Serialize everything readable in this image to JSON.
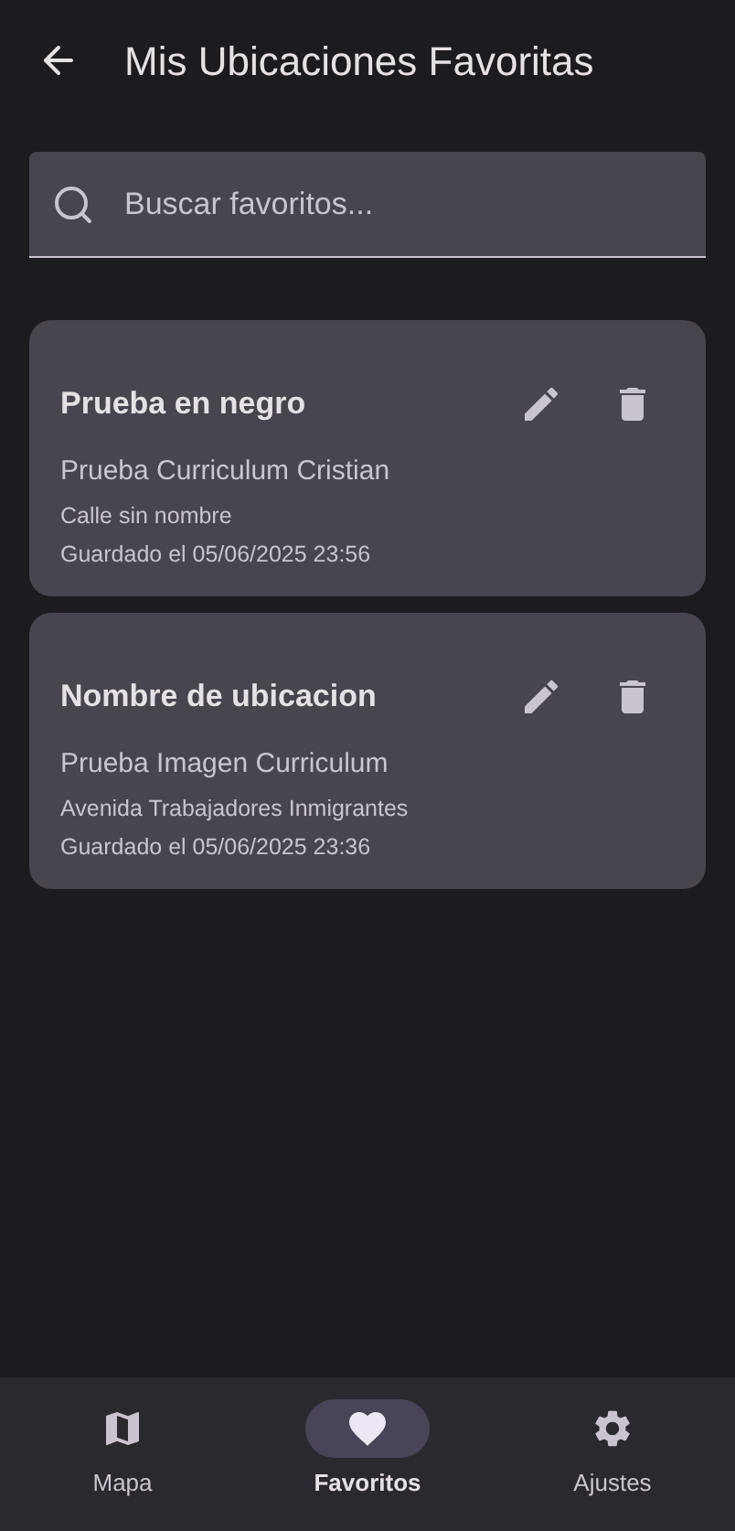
{
  "app_bar": {
    "title": "Mis Ubicaciones Favoritas"
  },
  "search": {
    "placeholder": "Buscar favoritos..."
  },
  "favorites": [
    {
      "name": "Prueba en negro",
      "description": "Prueba Curriculum Cristian",
      "address": "Calle sin nombre",
      "saved": "Guardado el 05/06/2025 23:56"
    },
    {
      "name": "Nombre de ubicacion",
      "description": "Prueba Imagen Curriculum",
      "address": "Avenida Trabajadores Inmigrantes",
      "saved": "Guardado el 05/06/2025 23:36"
    }
  ],
  "nav": [
    {
      "kind": "map",
      "label": "Mapa",
      "selected": false
    },
    {
      "kind": "heart",
      "label": "Favoritos",
      "selected": true
    },
    {
      "kind": "gear",
      "label": "Ajustes",
      "selected": false
    }
  ]
}
